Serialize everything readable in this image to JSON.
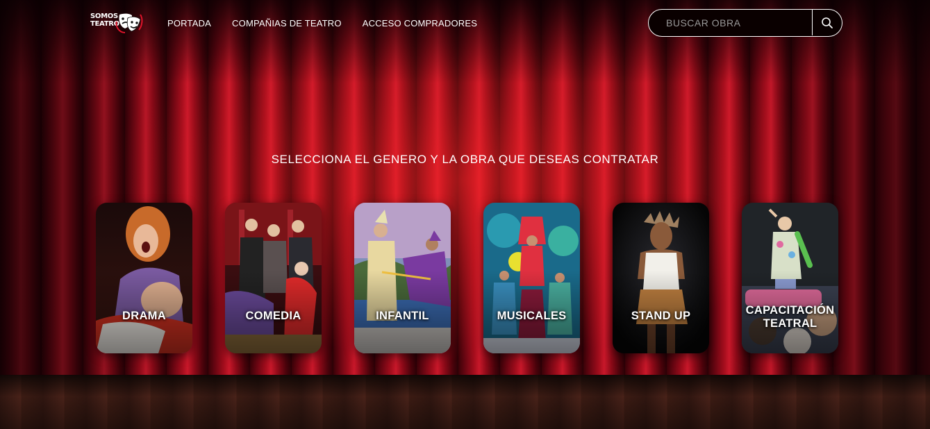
{
  "logo": {
    "line1": "SOMOS",
    "line2": "TEATRO",
    "icon": "theater-masks-icon"
  },
  "nav": {
    "items": [
      {
        "label": "PORTADA"
      },
      {
        "label": "COMPAÑIAS DE TEATRO"
      },
      {
        "label": "ACCESO COMPRADORES"
      }
    ]
  },
  "search": {
    "placeholder": "BUSCAR OBRA",
    "value": "",
    "icon": "search-icon"
  },
  "headline": "SELECCIONA EL GENERO Y LA OBRA QUE DESEAS CONTRATAR",
  "genres": [
    {
      "label": "DRAMA"
    },
    {
      "label": "COMEDIA"
    },
    {
      "label": "INFANTIL"
    },
    {
      "label": "MUSICALES"
    },
    {
      "label": "STAND UP"
    },
    {
      "label": "CAPACITACIÓN TEATRAL"
    }
  ],
  "colors": {
    "curtain": "#a10d1c",
    "accent": "#c8182a",
    "text": "#ffffff"
  }
}
